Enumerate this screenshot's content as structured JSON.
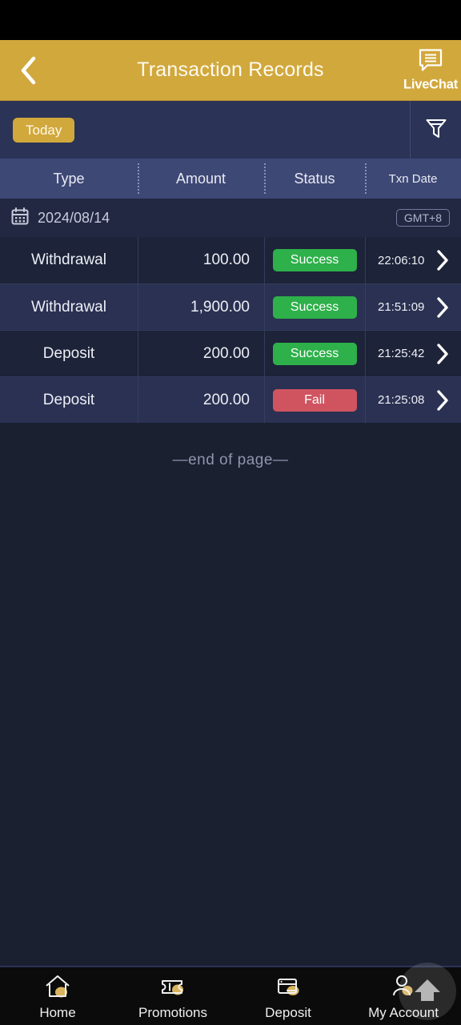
{
  "app_bar": {
    "back_icon": "chevron-left-icon",
    "title": "Transaction Records",
    "livechat_label": "LiveChat",
    "livechat_icon": "chat-bubble-icon",
    "bg_color": "#d1a83c"
  },
  "filter_bar": {
    "chips": [
      {
        "label": "Today",
        "active": true
      }
    ],
    "filter_icon": "funnel-icon",
    "bg_color": "#2b3356"
  },
  "table": {
    "columns": [
      "Type",
      "Amount",
      "Status",
      "Txn Date"
    ],
    "header_bg": "#3e4875",
    "date_group": {
      "calendar_icon": "calendar-icon",
      "date": "2024/08/14",
      "timezone_badge": "GMT+8"
    },
    "rows": [
      {
        "type": "Withdrawal",
        "amount": "100.00",
        "status": "Success",
        "status_kind": "success",
        "time": "22:06:10",
        "chevron": "chevron-right-icon"
      },
      {
        "type": "Withdrawal",
        "amount": "1,900.00",
        "status": "Success",
        "status_kind": "success",
        "time": "21:51:09",
        "chevron": "chevron-right-icon"
      },
      {
        "type": "Deposit",
        "amount": "200.00",
        "status": "Success",
        "status_kind": "success",
        "time": "21:25:42",
        "chevron": "chevron-right-icon"
      },
      {
        "type": "Deposit",
        "amount": "200.00",
        "status": "Fail",
        "status_kind": "fail",
        "time": "21:25:08",
        "chevron": "chevron-right-icon"
      }
    ],
    "success_color": "#2eb04a",
    "fail_color": "#cf5460"
  },
  "end_of_page": "—end of page—",
  "bottom_nav": {
    "items": [
      {
        "label": "Home",
        "icon": "home-icon"
      },
      {
        "label": "Promotions",
        "icon": "ticket-coin-icon"
      },
      {
        "label": "Deposit",
        "icon": "card-coin-icon"
      },
      {
        "label": "My Account",
        "icon": "user-coin-icon"
      }
    ],
    "accent_color": "#d9b35e",
    "bg_color": "#0b0b0b"
  },
  "scroll_top_button": {
    "icon": "arrow-up-icon"
  }
}
